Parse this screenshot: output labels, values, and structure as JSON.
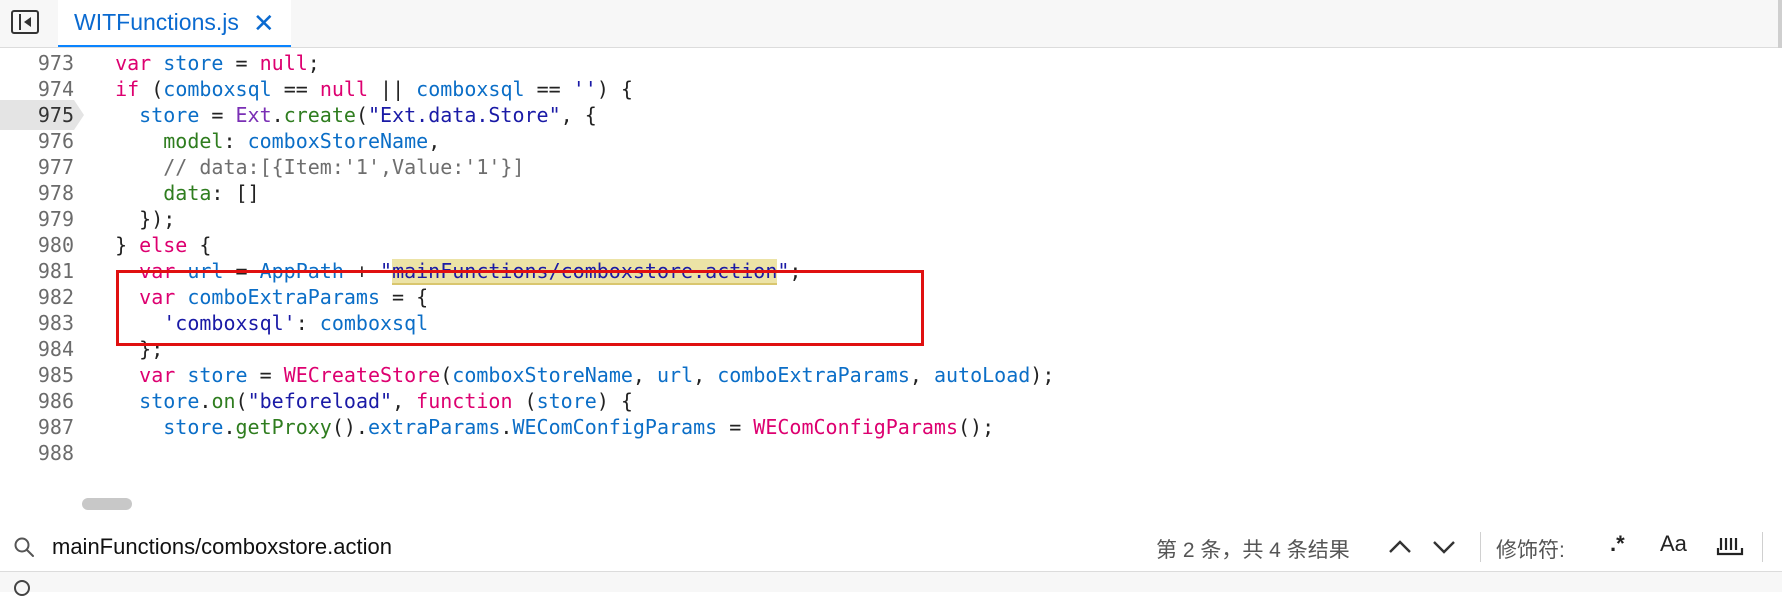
{
  "tab": {
    "filename": "WITFunctions.js",
    "close_icon": "close-icon"
  },
  "editor": {
    "active_line": 975,
    "lines": [
      {
        "n": "973",
        "text": "  var store = null;"
      },
      {
        "n": "974",
        "text": "  if (comboxsql == null || comboxsql == '') {"
      },
      {
        "n": "975",
        "text": "    store = Ext.create(\"Ext.data.Store\", {"
      },
      {
        "n": "976",
        "text": "      model: comboxStoreName,"
      },
      {
        "n": "977",
        "text": "      // data:[{Item:'1',Value:'1'}]"
      },
      {
        "n": "978",
        "text": "      data: []"
      },
      {
        "n": "979",
        "text": "    });"
      },
      {
        "n": "980",
        "text": "  } else {"
      },
      {
        "n": "981",
        "text": "    var url = AppPath + \"mainFunctions/comboxstore.action\";"
      },
      {
        "n": "982",
        "text": "    var comboExtraParams = {"
      },
      {
        "n": "983",
        "text": "      'comboxsql': comboxsql"
      },
      {
        "n": "984",
        "text": "    };"
      },
      {
        "n": "985",
        "text": "    var store = WECreateStore(comboxStoreName, url, comboExtraParams, autoLoad);"
      },
      {
        "n": "986",
        "text": "    store.on(\"beforeload\", function (store) {"
      },
      {
        "n": "987",
        "text": "      store.getProxy().extraParams.WEComConfigParams = WEComConfigParams();"
      },
      {
        "n": "988",
        "text": ""
      }
    ]
  },
  "search": {
    "query": "mainFunctions/comboxstore.action",
    "result_text": "第 2 条，共 4 条结果",
    "modifiers_label": "修饰符:",
    "regex_label": ".*",
    "case_label": "Aa",
    "whole_word_icon": "whole-word-icon"
  },
  "colors": {
    "accent": "#0a84ff",
    "highlight_box": "#e01010",
    "match_bg": "#ece3a6"
  }
}
